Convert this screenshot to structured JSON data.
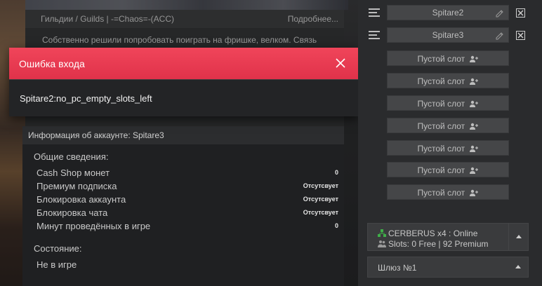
{
  "forum": {
    "header_left": "Гильдии / Guilds | -=Chaos=-(ACC)",
    "header_right": "Подробнее...",
    "text": "Собственно решили попробовать поиграть на фришке, велком. Связь"
  },
  "modal": {
    "title": "Ошибка входа",
    "message": "Spitare2:no_pc_empty_slots_left",
    "header_color": "#e8394f"
  },
  "account": {
    "title": "Информация об аккаунте: Spitare3",
    "general_title": "Общие сведения:",
    "rows": [
      {
        "label": "Cash Shop монет",
        "value": "0"
      },
      {
        "label": "Премиум подписка",
        "value": "Отсутсвует"
      },
      {
        "label": "Блокировка аккаунта",
        "value": "Отсутсвует"
      },
      {
        "label": "Блокировка чата",
        "value": "Отсутсвует"
      },
      {
        "label": "Минут проведённых в игре",
        "value": "0"
      }
    ],
    "state_title": "Состояние:",
    "state_value": "Не в игре"
  },
  "slots": {
    "named": [
      {
        "label": "Spitare2"
      },
      {
        "label": "Spitare3"
      }
    ],
    "empty_label": "Пустой слот",
    "empty_count": 7
  },
  "server": {
    "line1": "CERBERUS x4 : Online",
    "line2": "Slots: 0 Free | 92 Premium",
    "icon_color": "#3fae49"
  },
  "gateway": {
    "label": "Шлюз №1"
  }
}
